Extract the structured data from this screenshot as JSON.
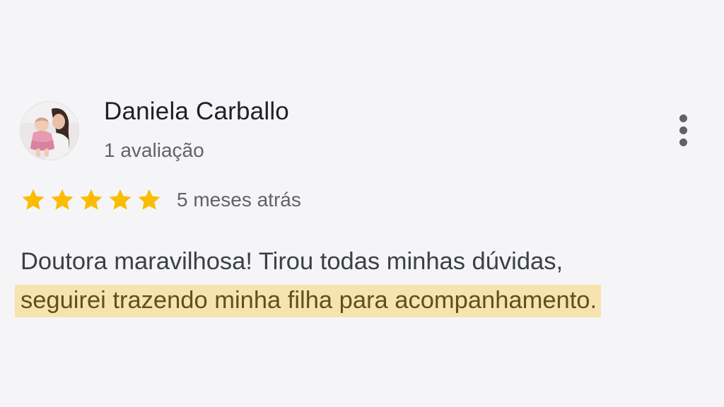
{
  "review": {
    "author": {
      "name": "Daniela Carballo",
      "meta": "1 avaliação",
      "avatar_icon": "user-photo-avatar"
    },
    "rating": {
      "value": 5,
      "max": 5,
      "star_color": "#fbbc04",
      "star_icon": "star-icon"
    },
    "date": "5 meses atrás",
    "text_lines": [
      "Doutora maravilhosa! Tirou todas minhas dúvidas,",
      "seguirei trazendo minha filha para acompanhamento."
    ],
    "highlight_color": "#f7e3ad",
    "more_icon": "more-vertical-icon"
  }
}
